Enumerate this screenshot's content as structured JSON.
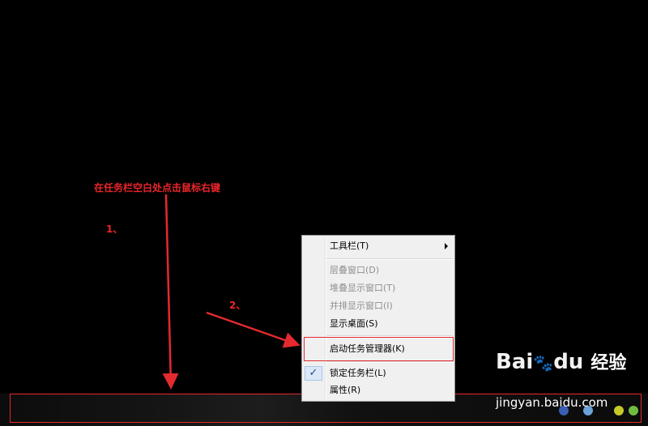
{
  "annotations": {
    "instruction": "在任务栏空白处点击鼠标右键",
    "step1": "1、",
    "step2": "2、",
    "color": "#e8262a"
  },
  "context_menu": {
    "items": [
      {
        "label": "工具栏(T)",
        "enabled": true,
        "submenu": true
      },
      {
        "label": "层叠窗口(D)",
        "enabled": false
      },
      {
        "label": "堆叠显示窗口(T)",
        "enabled": false
      },
      {
        "label": "并排显示窗口(I)",
        "enabled": false
      },
      {
        "label": "显示桌面(S)",
        "enabled": true
      },
      {
        "label": "启动任务管理器(K)",
        "enabled": true,
        "highlighted": true
      },
      {
        "label": "锁定任务栏(L)",
        "enabled": true,
        "checked": true
      },
      {
        "label": "属性(R)",
        "enabled": true
      }
    ],
    "check_mark": "✓"
  },
  "watermark": {
    "logo": "Bai",
    "paw": "🐾",
    "logo_suffix": "du",
    "brand": "经验",
    "url": "jingyan.baidu.com"
  }
}
